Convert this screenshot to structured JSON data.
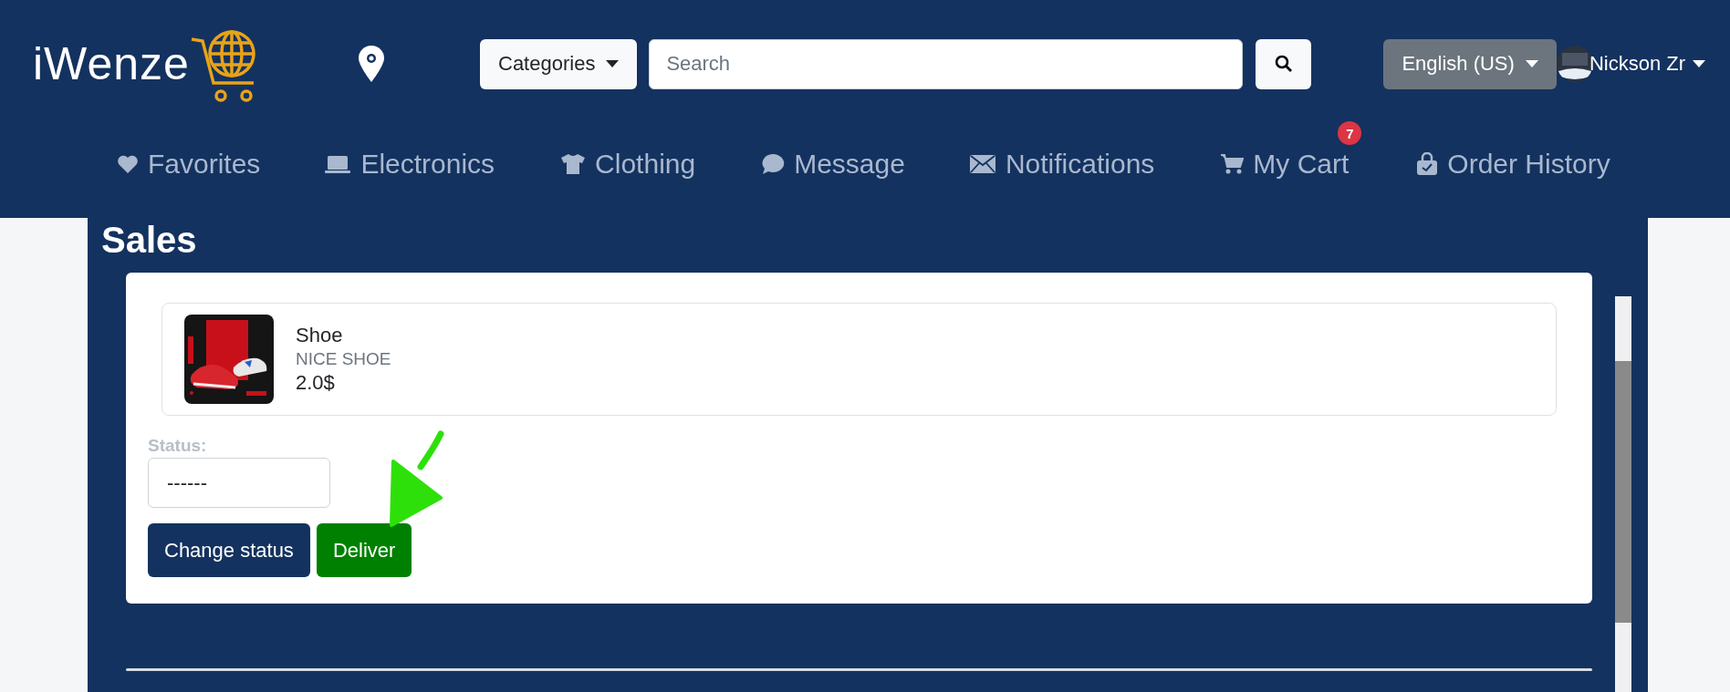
{
  "header": {
    "logo": "iWenze",
    "categories": "Categories",
    "search": {
      "placeholder": "Search"
    },
    "language": "English (US)",
    "user": "Nickson Zr"
  },
  "nav": [
    {
      "label": "Favorites"
    },
    {
      "label": "Electronics"
    },
    {
      "label": "Clothing"
    },
    {
      "label": "Message"
    },
    {
      "label": "Notifications"
    },
    {
      "label": "My Cart",
      "badge": "7"
    },
    {
      "label": "Order History"
    }
  ],
  "page_title": "Sales",
  "order": {
    "product": {
      "name": "Shoe",
      "description": "NICE SHOE",
      "price": "2.0$"
    },
    "status_label": "Status:",
    "status_value": "------",
    "buttons": [
      {
        "label": "Change status",
        "kind": "primary"
      },
      {
        "label": "Deliver",
        "kind": "success"
      }
    ]
  }
}
